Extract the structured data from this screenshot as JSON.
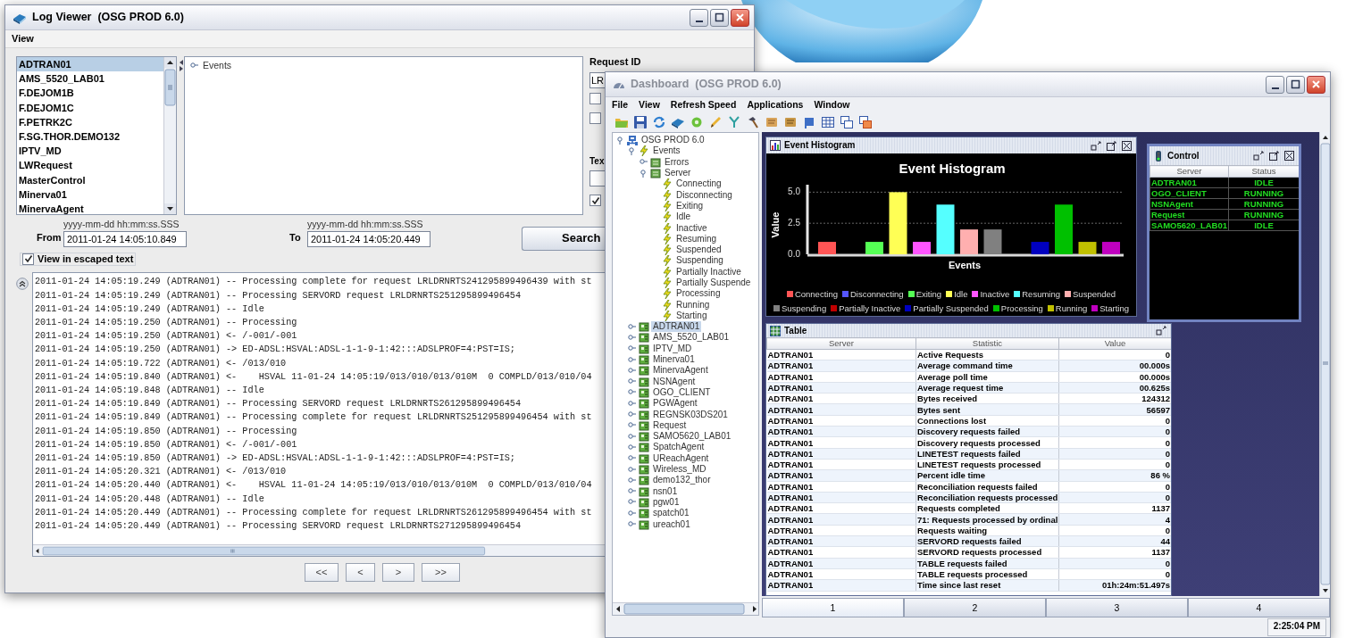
{
  "log_viewer": {
    "title": "Log Viewer  (OSG PROD 6.0)",
    "menu": [
      "View"
    ],
    "servers": [
      {
        "label": "ADTRAN01",
        "selected": true
      },
      {
        "label": "AMS_5520_LAB01",
        "selected": false
      },
      {
        "label": "F.DEJOM1B",
        "selected": false
      },
      {
        "label": "F.DEJOM1C",
        "selected": false
      },
      {
        "label": "F.PETRK2C",
        "selected": false
      },
      {
        "label": "F.SG.THOR.DEMO132",
        "selected": false
      },
      {
        "label": "IPTV_MD",
        "selected": false
      },
      {
        "label": "LWRequest",
        "selected": false
      },
      {
        "label": "MasterControl",
        "selected": false
      },
      {
        "label": "Minerva01",
        "selected": false
      },
      {
        "label": "MinervaAgent",
        "selected": false
      }
    ],
    "event_tree": [
      {
        "label": "Events",
        "expanded": false
      }
    ],
    "request_id": {
      "label": "Request ID",
      "value": "LR"
    },
    "filters": [
      {
        "checked": false
      },
      {
        "checked": false
      }
    ],
    "text_filter": {
      "label": "Tex",
      "option_checked": true
    },
    "from": {
      "label": "From",
      "format_hint": "yyyy-mm-dd hh:mm:ss.SSS",
      "value": "2011-01-24 14:05:10.849"
    },
    "to": {
      "label": "To",
      "format_hint": "yyyy-mm-dd hh:mm:ss.SSS",
      "value": "2011-01-24 14:05:20.449"
    },
    "search_button": "Search",
    "escaped_text": {
      "label": "View in escaped text",
      "checked": true
    },
    "log_lines": [
      "2011-01-24 14:05:19.249 (ADTRAN01) -- Processing complete for request LRLDRNRTS241295899496439 with st",
      "2011-01-24 14:05:19.249 (ADTRAN01) -- Processing SERVORD request LRLDRNRTS251295899496454",
      "2011-01-24 14:05:19.249 (ADTRAN01) -- Idle",
      "2011-01-24 14:05:19.250 (ADTRAN01) -- Processing",
      "2011-01-24 14:05:19.250 (ADTRAN01) <- /-001/-001",
      "2011-01-24 14:05:19.250 (ADTRAN01) -> ED-ADSL:HSVAL:ADSL-1-1-9-1:42:::ADSLPROF=4:PST=IS;",
      "2011-01-24 14:05:19.722 (ADTRAN01) <- /013/010",
      "2011-01-24 14:05:19.840 (ADTRAN01) <-    HSVAL 11-01-24 14:05:19/013/010/013/010M  0 COMPLD/013/010/04",
      "2011-01-24 14:05:19.848 (ADTRAN01) -- Idle",
      "2011-01-24 14:05:19.849 (ADTRAN01) -- Processing SERVORD request LRLDRNRTS261295899496454",
      "2011-01-24 14:05:19.849 (ADTRAN01) -- Processing complete for request LRLDRNRTS251295899496454 with st",
      "2011-01-24 14:05:19.850 (ADTRAN01) -- Processing",
      "2011-01-24 14:05:19.850 (ADTRAN01) <- /-001/-001",
      "2011-01-24 14:05:19.850 (ADTRAN01) -> ED-ADSL:HSVAL:ADSL-1-1-9-1:42:::ADSLPROF=4:PST=IS;",
      "2011-01-24 14:05:20.321 (ADTRAN01) <- /013/010",
      "2011-01-24 14:05:20.440 (ADTRAN01) <-    HSVAL 11-01-24 14:05:19/013/010/013/010M  0 COMPLD/013/010/04",
      "2011-01-24 14:05:20.448 (ADTRAN01) -- Idle",
      "2011-01-24 14:05:20.449 (ADTRAN01) -- Processing complete for request LRLDRNRTS261295899496454 with st",
      "2011-01-24 14:05:20.449 (ADTRAN01) -- Processing SERVORD request LRLDRNRTS271295899496454"
    ],
    "pager": [
      "<<",
      "<",
      ">",
      ">>"
    ]
  },
  "dashboard": {
    "title": "Dashboard  (OSG PROD 6.0)",
    "menu": [
      "File",
      "View",
      "Refresh Speed",
      "Applications",
      "Window"
    ],
    "tree": [
      {
        "label": "OSG PROD 6.0",
        "kind": "network",
        "expanded": true,
        "selected": false,
        "children": [
          {
            "label": "Events",
            "kind": "event",
            "expanded": true,
            "selected": false,
            "children": [
              {
                "label": "Errors",
                "kind": "group",
                "expanded": false,
                "selected": false
              },
              {
                "label": "Server",
                "kind": "group",
                "expanded": true,
                "selected": false,
                "children": [
                  {
                    "label": "Connecting",
                    "kind": "event",
                    "selected": false
                  },
                  {
                    "label": "Disconnecting",
                    "kind": "event",
                    "selected": false
                  },
                  {
                    "label": "Exiting",
                    "kind": "event",
                    "selected": false
                  },
                  {
                    "label": "Idle",
                    "kind": "event",
                    "selected": false
                  },
                  {
                    "label": "Inactive",
                    "kind": "event",
                    "selected": false
                  },
                  {
                    "label": "Resuming",
                    "kind": "event",
                    "selected": false
                  },
                  {
                    "label": "Suspended",
                    "kind": "event",
                    "selected": false
                  },
                  {
                    "label": "Suspending",
                    "kind": "event",
                    "selected": false
                  },
                  {
                    "label": "Partially Inactive",
                    "kind": "event",
                    "selected": false
                  },
                  {
                    "label": "Partially Suspende",
                    "kind": "event",
                    "selected": false
                  },
                  {
                    "label": "Processing",
                    "kind": "event",
                    "selected": false
                  },
                  {
                    "label": "Running",
                    "kind": "event",
                    "selected": false
                  },
                  {
                    "label": "Starting",
                    "kind": "event",
                    "selected": false
                  }
                ]
              }
            ]
          },
          {
            "label": "ADTRAN01",
            "kind": "server",
            "expanded": false,
            "selected": true
          },
          {
            "label": "AMS_5520_LAB01",
            "kind": "server",
            "expanded": false,
            "selected": false
          },
          {
            "label": "IPTV_MD",
            "kind": "server",
            "expanded": false,
            "selected": false
          },
          {
            "label": "Minerva01",
            "kind": "server",
            "expanded": false,
            "selected": false
          },
          {
            "label": "MinervaAgent",
            "kind": "server",
            "expanded": false,
            "selected": false
          },
          {
            "label": "NSNAgent",
            "kind": "server",
            "expanded": false,
            "selected": false
          },
          {
            "label": "OGO_CLIENT",
            "kind": "server",
            "expanded": false,
            "selected": false
          },
          {
            "label": "PGWAgent",
            "kind": "server",
            "expanded": false,
            "selected": false
          },
          {
            "label": "REGNSK03DS201",
            "kind": "server",
            "expanded": false,
            "selected": false
          },
          {
            "label": "Request",
            "kind": "server",
            "expanded": false,
            "selected": false
          },
          {
            "label": "SAMO5620_LAB01",
            "kind": "server",
            "expanded": false,
            "selected": false
          },
          {
            "label": "SpatchAgent",
            "kind": "server",
            "expanded": false,
            "selected": false
          },
          {
            "label": "UReachAgent",
            "kind": "server",
            "expanded": false,
            "selected": false
          },
          {
            "label": "Wireless_MD",
            "kind": "server",
            "expanded": false,
            "selected": false
          },
          {
            "label": "demo132_thor",
            "kind": "server",
            "expanded": false,
            "selected": false
          },
          {
            "label": "nsn01",
            "kind": "server",
            "expanded": false,
            "selected": false
          },
          {
            "label": "pgw01",
            "kind": "server",
            "expanded": false,
            "selected": false
          },
          {
            "label": "spatch01",
            "kind": "server",
            "expanded": false,
            "selected": false
          },
          {
            "label": "ureach01",
            "kind": "server",
            "expanded": false,
            "selected": false
          }
        ]
      }
    ],
    "histogram": {
      "title": "Event Histogram",
      "chart_data": {
        "type": "bar",
        "legend": "bottom",
        "title": "Event Histogram",
        "xlabel": "Events",
        "ylabel": "Value",
        "ylim": [
          0,
          5.6
        ],
        "yticks": [
          {
            "value": 0,
            "label": "0.0"
          },
          {
            "value": 2.5,
            "label": "2.5"
          },
          {
            "value": 5,
            "label": "5.0"
          }
        ],
        "series": [
          {
            "name": "Connecting",
            "color": "#ff5555",
            "values": [
              1
            ]
          },
          {
            "name": "Disconnecting",
            "color": "#5555ff",
            "values": [
              0
            ]
          },
          {
            "name": "Exiting",
            "color": "#55ff55",
            "values": [
              1
            ]
          },
          {
            "name": "Idle",
            "color": "#ffff55",
            "values": [
              5
            ]
          },
          {
            "name": "Inactive",
            "color": "#ff55ff",
            "values": [
              1
            ]
          },
          {
            "name": "Resuming",
            "color": "#55ffff",
            "values": [
              4
            ]
          },
          {
            "name": "Suspended",
            "color": "#ffafaf",
            "values": [
              2
            ]
          },
          {
            "name": "Suspending",
            "color": "#808080",
            "values": [
              2
            ]
          },
          {
            "name": "Partially Inactive",
            "color": "#c00000",
            "values": [
              0
            ]
          },
          {
            "name": "Partially Suspended",
            "color": "#0000c0",
            "values": [
              1
            ]
          },
          {
            "name": "Processing",
            "color": "#00c000",
            "values": [
              4
            ]
          },
          {
            "name": "Running",
            "color": "#c0c000",
            "values": [
              1
            ]
          },
          {
            "name": "Starting",
            "color": "#c000c0",
            "values": [
              1
            ]
          }
        ]
      }
    },
    "table": {
      "title": "Table",
      "columns": [
        "Server",
        "Statistic",
        "Value"
      ],
      "rows": [
        [
          "ADTRAN01",
          "Active Requests",
          "0"
        ],
        [
          "ADTRAN01",
          "Average command time",
          "00.000s"
        ],
        [
          "ADTRAN01",
          "Average poll time",
          "00.000s"
        ],
        [
          "ADTRAN01",
          "Average request time",
          "00.625s"
        ],
        [
          "ADTRAN01",
          "Bytes received",
          "124312"
        ],
        [
          "ADTRAN01",
          "Bytes sent",
          "56597"
        ],
        [
          "ADTRAN01",
          "Connections lost",
          "0"
        ],
        [
          "ADTRAN01",
          "Discovery requests failed",
          "0"
        ],
        [
          "ADTRAN01",
          "Discovery requests processed",
          "0"
        ],
        [
          "ADTRAN01",
          "LINETEST requests failed",
          "0"
        ],
        [
          "ADTRAN01",
          "LINETEST requests processed",
          "0"
        ],
        [
          "ADTRAN01",
          "Percent idle time",
          "86 %"
        ],
        [
          "ADTRAN01",
          "Reconciliation requests failed",
          "0"
        ],
        [
          "ADTRAN01",
          "Reconciliation requests processed",
          "0"
        ],
        [
          "ADTRAN01",
          "Requests completed",
          "1137"
        ],
        [
          "ADTRAN01",
          "71: Requests processed by ordinal",
          "4"
        ],
        [
          "ADTRAN01",
          "Requests waiting",
          "0"
        ],
        [
          "ADTRAN01",
          "SERVORD requests failed",
          "44"
        ],
        [
          "ADTRAN01",
          "SERVORD requests processed",
          "1137"
        ],
        [
          "ADTRAN01",
          "TABLE requests failed",
          "0"
        ],
        [
          "ADTRAN01",
          "TABLE requests processed",
          "0"
        ],
        [
          "ADTRAN01",
          "Time since last reset",
          "01h:24m:51.497s"
        ]
      ]
    },
    "control": {
      "title": "Control",
      "columns": [
        "Server",
        "Status"
      ],
      "rows": [
        [
          "ADTRAN01",
          "IDLE"
        ],
        [
          "OGO_CLIENT",
          "RUNNING"
        ],
        [
          "NSNAgent",
          "RUNNING"
        ],
        [
          "Request",
          "RUNNING"
        ],
        [
          "SAMO5620_LAB01",
          "IDLE"
        ]
      ]
    },
    "tabs": [
      {
        "label": "1",
        "selected": true
      },
      {
        "label": "2",
        "selected": false
      },
      {
        "label": "3",
        "selected": false
      },
      {
        "label": "4",
        "selected": false
      }
    ],
    "status_time": "2:25:04 PM"
  }
}
